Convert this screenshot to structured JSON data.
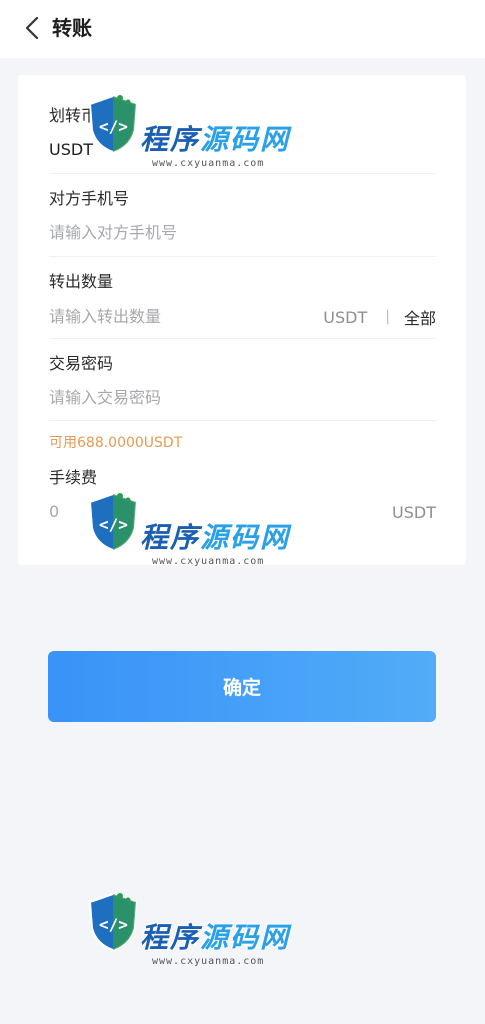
{
  "header": {
    "title": "转账"
  },
  "form": {
    "coin": {
      "label": "划转币种",
      "value": "USDT"
    },
    "phone": {
      "label": "对方手机号",
      "placeholder": "请输入对方手机号"
    },
    "amount": {
      "label": "转出数量",
      "placeholder": "请输入转出数量",
      "unit": "USDT",
      "separator": "|",
      "all_label": "全部"
    },
    "password": {
      "label": "交易密码",
      "placeholder": "请输入交易密码"
    },
    "available": "可用688.0000USDT",
    "fee": {
      "label": "手续费",
      "value": "0",
      "unit": "USDT"
    }
  },
  "confirm_label": "确定",
  "watermark": {
    "title_part1": "程序",
    "title_part2": "源码网",
    "url": "www.cxyuanma.com"
  },
  "colors": {
    "accent_blue": "#2f8ef8",
    "available_orange": "#e49b52",
    "page_bg": "#f3f5f9"
  }
}
